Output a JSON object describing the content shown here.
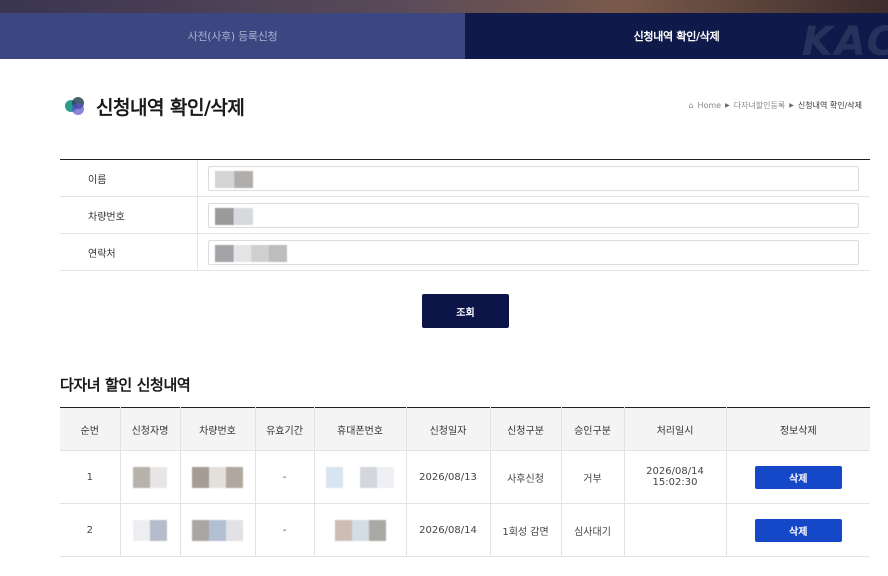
{
  "tabs": [
    {
      "label": "사전(사후) 등록신청",
      "active": false
    },
    {
      "label": "신청내역 확인/삭제",
      "active": true
    }
  ],
  "watermark": "KAC",
  "page": {
    "title": "신청내역 확인/삭제",
    "breadcrumb": [
      "Home",
      "다자녀할인등록",
      "신청내역 확인/삭제"
    ]
  },
  "form": {
    "fields": [
      {
        "label": "이름",
        "value": ""
      },
      {
        "label": "차량번호",
        "value": ""
      },
      {
        "label": "연락처",
        "value": ""
      }
    ],
    "search_label": "조회"
  },
  "results": {
    "title": "다자녀 할인 신청내역",
    "columns": [
      "순번",
      "신청자명",
      "차량번호",
      "유효기간",
      "휴대폰번호",
      "신청일자",
      "신청구분",
      "승인구분",
      "처리일시",
      "정보삭제"
    ],
    "rows": [
      {
        "no": "1",
        "name": "",
        "car": "",
        "valid": "-",
        "phone": "",
        "date": "2026/08/13",
        "type": "사후신청",
        "approval": "거부",
        "processed": "2026/08/14 15:02:30",
        "delete_label": "삭제"
      },
      {
        "no": "2",
        "name": "",
        "car": "",
        "valid": "-",
        "phone": "",
        "date": "2026/08/14",
        "type": "1회성 감면",
        "approval": "심사대기",
        "processed": "",
        "delete_label": "삭제"
      }
    ]
  },
  "colors": {
    "tab_inactive": "#3c4782",
    "tab_active": "#0f1a4a",
    "search_button": "#0d1448",
    "delete_button": "#1448c8"
  }
}
